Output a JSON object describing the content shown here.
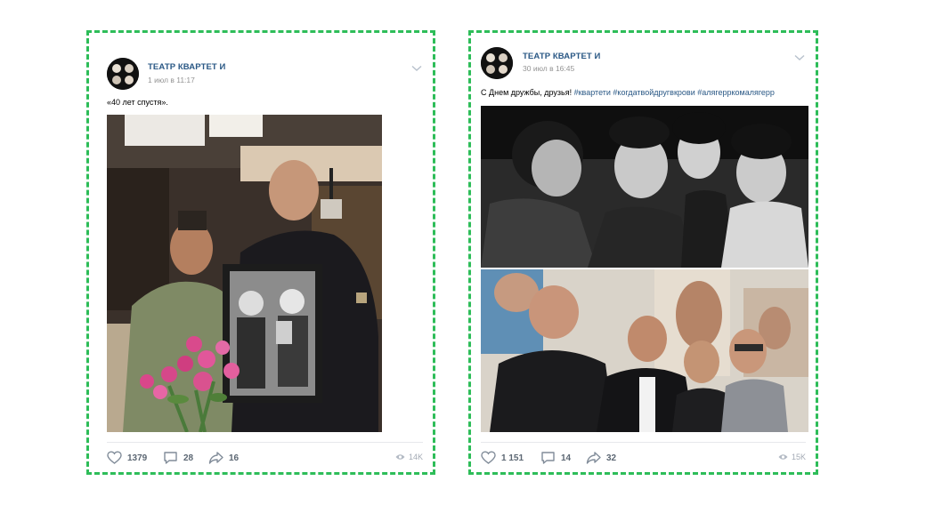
{
  "posts": [
    {
      "author": "ТЕАТР КВАРТЕТ И",
      "date": "1 июл в 11:17",
      "text": "«40 лет спустя».",
      "hashtags": "",
      "likes": "1379",
      "comments": "28",
      "shares": "16",
      "views": "14K"
    },
    {
      "author": "ТЕАТР КВАРТЕТ И",
      "date": "30 июл в 16:45",
      "text": "С Днем дружбы, друзья! ",
      "hashtags": "#квартети #когдатвойдругвкрови #алягерркомалягерр",
      "likes": "1 151",
      "comments": "14",
      "shares": "32",
      "views": "15K"
    }
  ],
  "colors": {
    "highlight_border": "#2ebd59",
    "link": "#2a5885",
    "meta": "#939393",
    "action": "#5c6773"
  },
  "icons": [
    "avatar",
    "chevron-down-icon",
    "heart-icon",
    "comment-icon",
    "share-icon",
    "eye-icon"
  ]
}
